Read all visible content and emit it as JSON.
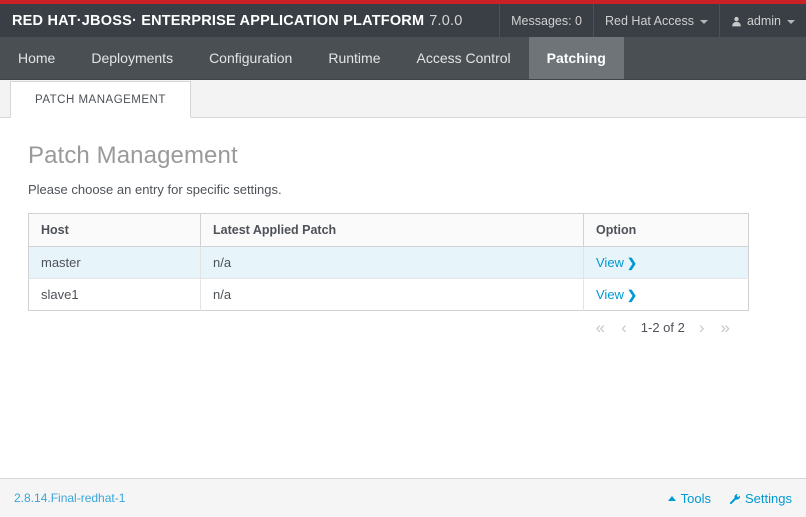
{
  "masthead": {
    "brand_bold": "RED HAT·JBOSS· ENTERPRISE APPLICATION PLATFORM",
    "brand_version": "7.0.0",
    "messages_label": "Messages: 0",
    "access_label": "Red Hat Access",
    "user_label": "admin",
    "colors": {
      "stripe": "#cc2027",
      "bar": "#393f44"
    }
  },
  "nav": {
    "items": [
      {
        "label": "Home",
        "active": false
      },
      {
        "label": "Deployments",
        "active": false
      },
      {
        "label": "Configuration",
        "active": false
      },
      {
        "label": "Runtime",
        "active": false
      },
      {
        "label": "Access Control",
        "active": false
      },
      {
        "label": "Patching",
        "active": true
      }
    ]
  },
  "subtabs": {
    "items": [
      {
        "label": "PATCH MANAGEMENT",
        "active": true
      }
    ]
  },
  "page": {
    "title": "Patch Management",
    "description": "Please choose an entry for specific settings."
  },
  "table": {
    "columns": [
      "Host",
      "Latest Applied Patch",
      "Option"
    ],
    "rows": [
      {
        "host": "master",
        "patch": "n/a",
        "option": "View",
        "selected": true
      },
      {
        "host": "slave1",
        "patch": "n/a",
        "option": "View",
        "selected": false
      }
    ]
  },
  "pagination": {
    "first": "«",
    "prev": "‹",
    "label": "1-2 of 2",
    "next": "›",
    "last": "»"
  },
  "footer": {
    "version": "2.8.14.Final-redhat-1",
    "tools_label": "Tools",
    "settings_label": "Settings",
    "link_color": "#0099d3"
  }
}
